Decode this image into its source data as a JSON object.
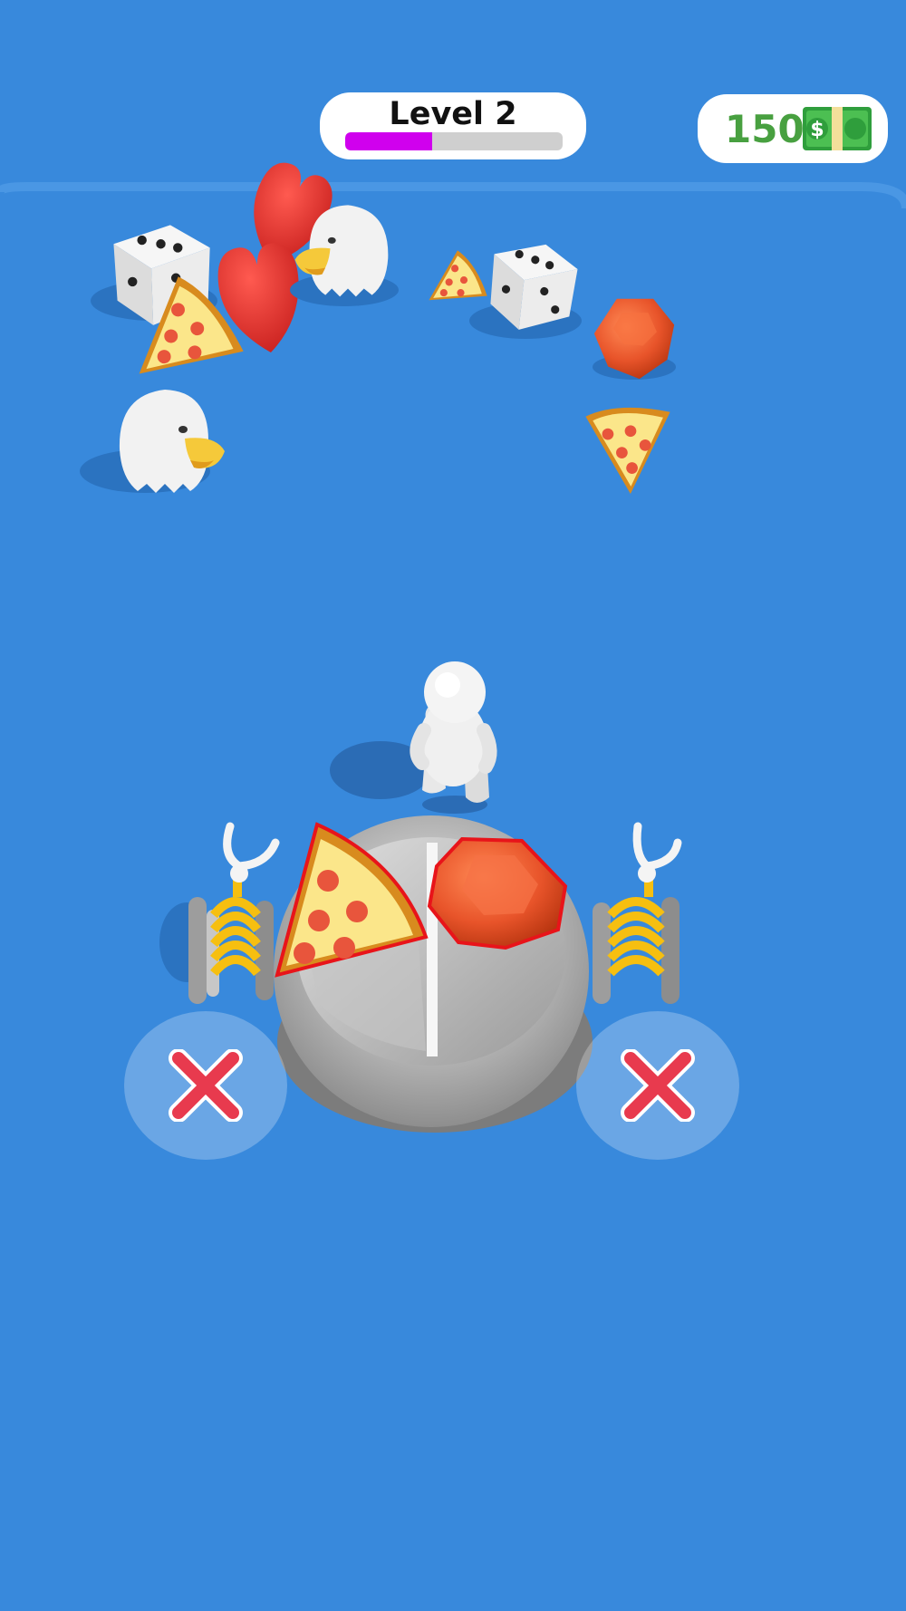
{
  "hud": {
    "level_label": "Level 2",
    "level_progress": 0.4,
    "coins": "150",
    "currency_symbol": "$",
    "progress_color": "#d000ee",
    "coin_color": "#48a040"
  },
  "scene": {
    "background": "#3889dc",
    "items": [
      "dice",
      "heart",
      "eagle",
      "pizza-slice",
      "gem"
    ],
    "held_items": [
      "pizza-slice",
      "gem"
    ],
    "character": "white-stickman"
  },
  "controls": {
    "left_button": "close-icon",
    "right_button": "close-icon"
  }
}
